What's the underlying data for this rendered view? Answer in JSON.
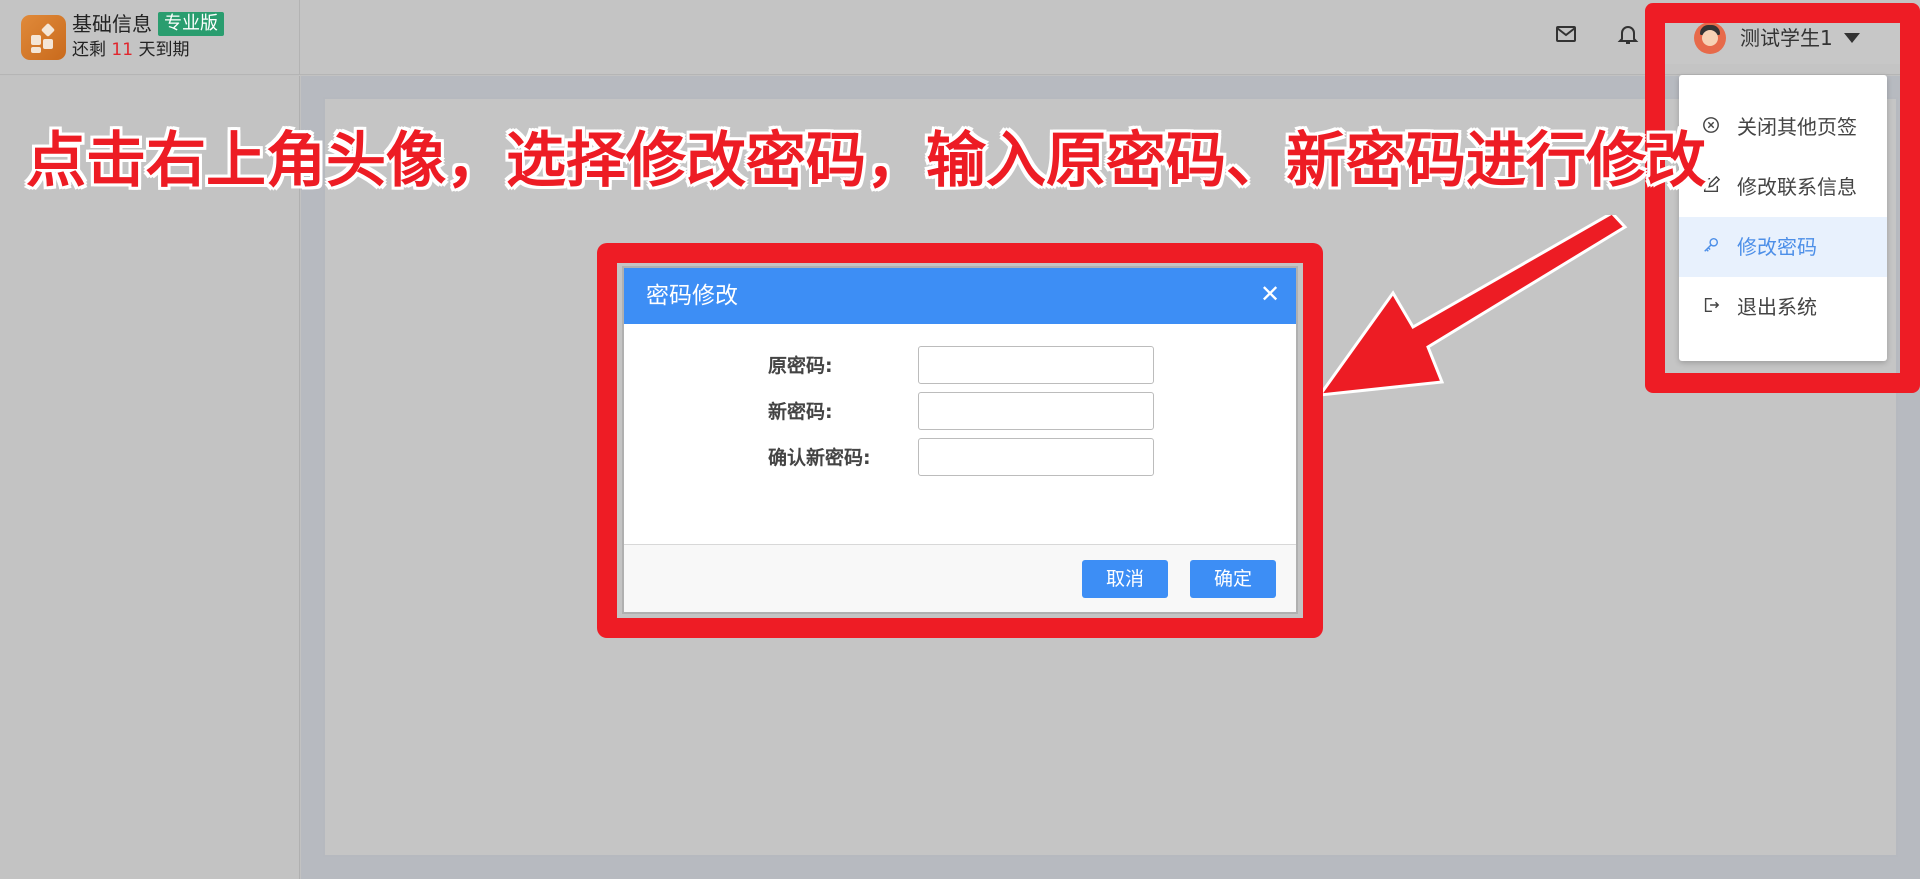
{
  "brand": {
    "name": "基础信息",
    "badge": "专业版",
    "expire_prefix": "还剩",
    "expire_days": "11",
    "expire_suffix": "天到期"
  },
  "header": {
    "mail_icon": "mail-icon",
    "bell_icon": "bell-icon",
    "user_name": "测试学生1"
  },
  "user_menu": {
    "items": [
      {
        "label": "关闭其他页签",
        "icon": "close-circle-icon"
      },
      {
        "label": "修改联系信息",
        "icon": "edit-icon"
      },
      {
        "label": "修改密码",
        "icon": "key-icon",
        "active": true
      },
      {
        "label": "退出系统",
        "icon": "logout-icon"
      }
    ]
  },
  "banner": {
    "text": "点击右上角头像，选择修改密码，输入原密码、新密码进行修改"
  },
  "dialog": {
    "title": "密码修改",
    "fields": [
      {
        "label": "原密码:",
        "value": ""
      },
      {
        "label": "新密码:",
        "value": ""
      },
      {
        "label": "确认新密码:",
        "value": ""
      }
    ],
    "cancel_label": "取消",
    "confirm_label": "确定"
  },
  "colors": {
    "accent": "#3d8ef5",
    "highlight_red": "#ee1c25",
    "badge_green": "#2a9d6f"
  }
}
